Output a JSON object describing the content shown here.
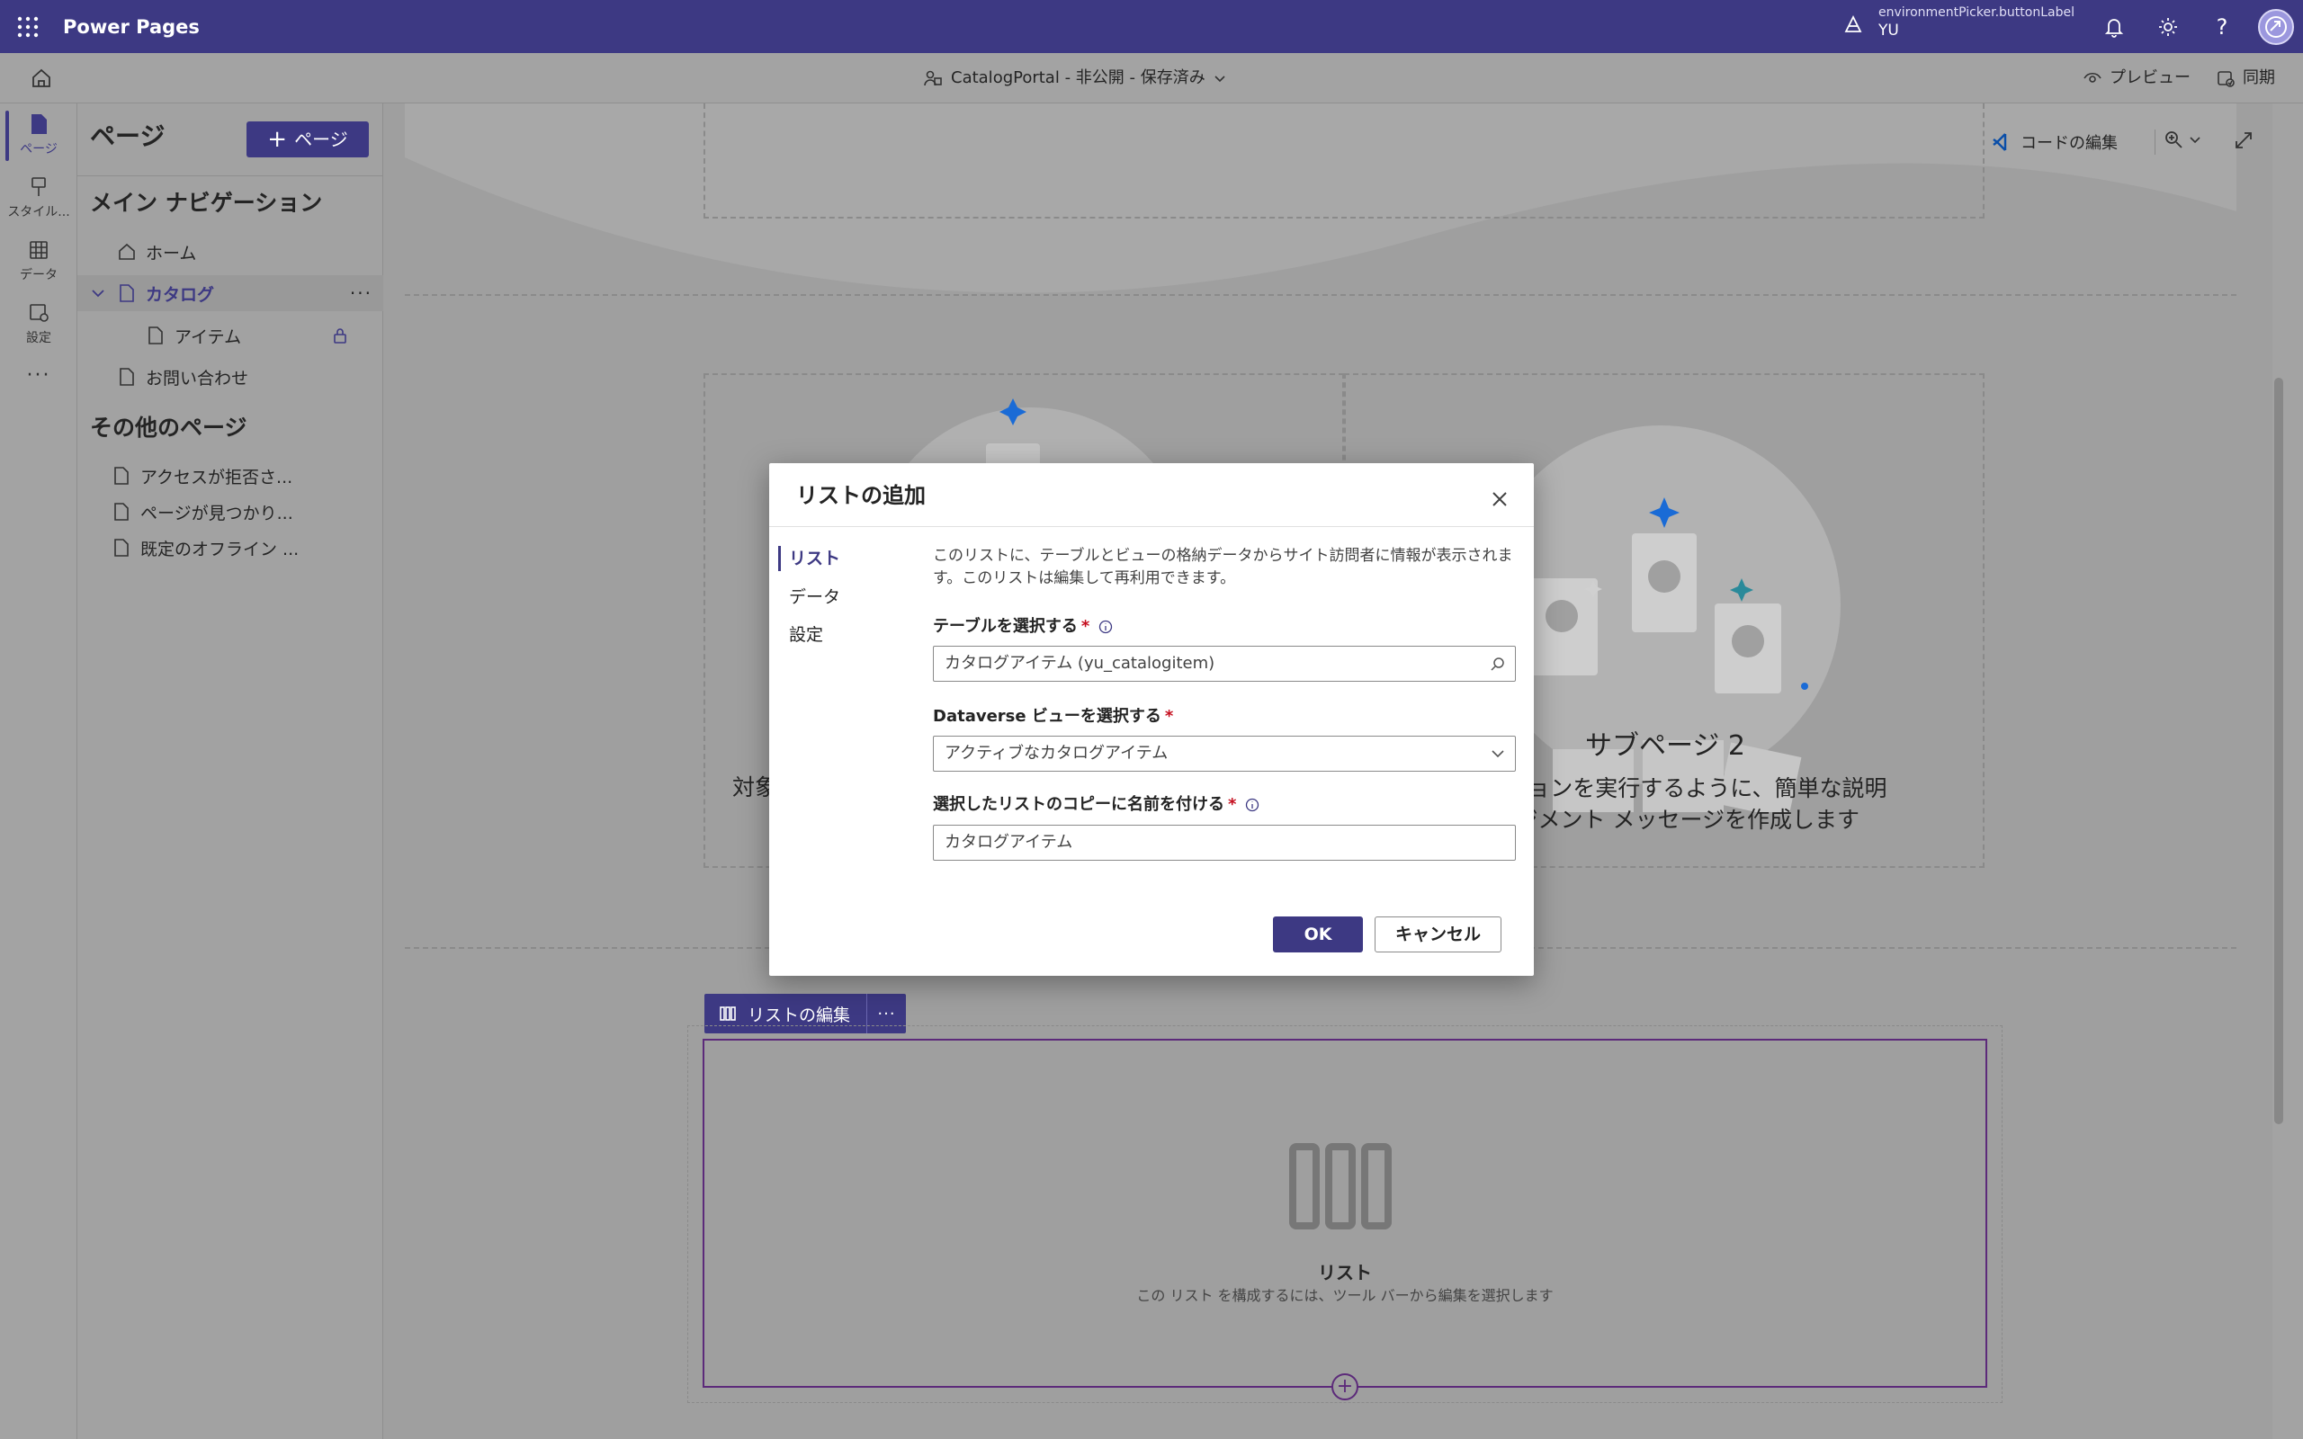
{
  "app": {
    "title": "Power Pages",
    "env_label": "environmentPicker.buttonLabel",
    "env_name": "YU"
  },
  "cmdbar": {
    "site": "CatalogPortal - 非公開 - 保存済み",
    "preview": "プレビュー",
    "sync": "同期",
    "edit_code": "コードの編集"
  },
  "rail": {
    "items": [
      {
        "label": "ページ",
        "icon": "page-icon"
      },
      {
        "label": "スタイル...",
        "icon": "paintbrush-icon"
      },
      {
        "label": "データ",
        "icon": "table-icon"
      },
      {
        "label": "設定",
        "icon": "settings-icon"
      }
    ]
  },
  "panel": {
    "title": "ページ",
    "add_button": "ページ",
    "main_nav_header": "メイン ナビゲーション",
    "main_nav": [
      {
        "label": "ホーム"
      },
      {
        "label": "カタログ"
      },
      {
        "label": "アイテム"
      },
      {
        "label": "お問い合わせ"
      }
    ],
    "other_header": "その他のページ",
    "other_pages": [
      {
        "label": "アクセスが拒否さ..."
      },
      {
        "label": "ページが見つかり..."
      },
      {
        "label": "既定のオフライン ..."
      }
    ]
  },
  "canvas": {
    "subpage_title": "サブページ 2",
    "subpage_text_line1": "アクションを実行するように、簡単な説明",
    "subpage_text_line2": "ゲージメント メッセージを作成します",
    "left_fragment": "対象",
    "list_edit_button": "リストの編集",
    "list_placeholder_title": "リスト",
    "list_placeholder_desc": "この リスト を構成するには、ツール バーから編集を選択します"
  },
  "modal": {
    "title": "リストの追加",
    "tabs": [
      "リスト",
      "データ",
      "設定"
    ],
    "description": "このリストに、テーブルとビューの格納データからサイト訪問者に情報が表示されます。このリストは編集して再利用できます。",
    "table_label": "テーブルを選択する",
    "table_value": "カタログアイテム (yu_catalogitem)",
    "view_label": "Dataverse ビューを選択する",
    "view_value": "アクティブなカタログアイテム",
    "name_label": "選択したリストのコピーに名前を付ける",
    "name_value": "カタログアイテム",
    "ok": "OK",
    "cancel": "キャンセル",
    "required_mark": "*"
  },
  "colors": {
    "brand": "#3d3983",
    "overlay": "#9e9e9e",
    "accent_star": "#1a6bd6"
  }
}
